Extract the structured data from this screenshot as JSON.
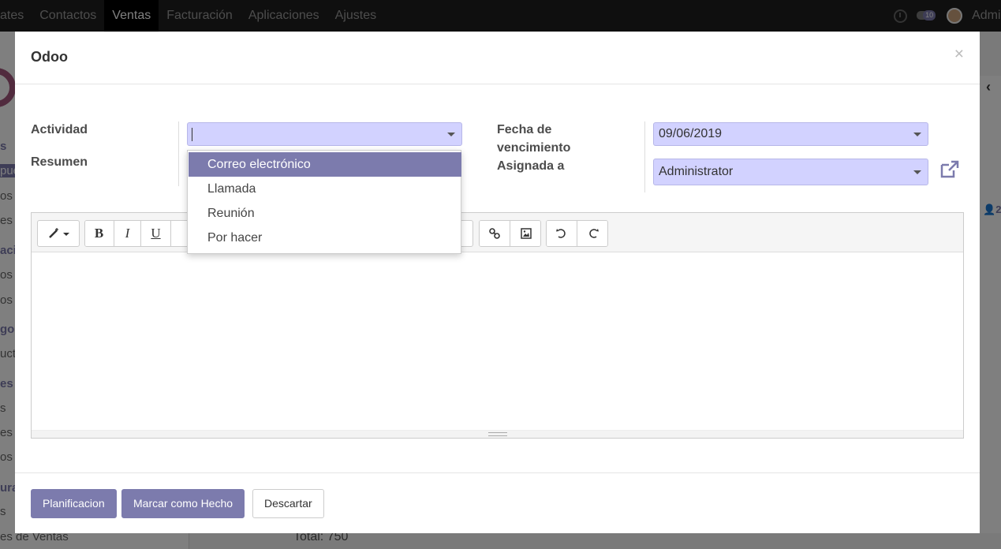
{
  "topbar": {
    "menu": [
      "ates",
      "Contactos",
      "Ventas",
      "Facturación",
      "Aplicaciones",
      "Ajustes"
    ],
    "active_menu": "Ventas",
    "message_count": "10",
    "user": "Admini"
  },
  "background": {
    "sidebar_items": [
      "s",
      "pue",
      "os",
      "es",
      "ació",
      "os",
      "os",
      "go",
      "ucto",
      "es",
      "s",
      "es",
      "os",
      "ura",
      "s",
      "es de Ventas"
    ],
    "total_text": "Total: 750",
    "right_count": "2"
  },
  "modal": {
    "title": "Odoo",
    "close": "×",
    "labels": {
      "actividad": "Actividad",
      "resumen": "Resumen",
      "fecha_line1": "Fecha de",
      "fecha_line2": "vencimiento",
      "asignada": "Asignada a"
    },
    "fields": {
      "actividad_value": "",
      "fecha_vencimiento": "09/06/2019",
      "asignada_a": "Administrator"
    },
    "dropdown": {
      "options": [
        "Correo electrónico",
        "Llamada",
        "Reunión",
        "Por hacer"
      ],
      "highlighted": "Correo electrónico"
    },
    "toolbar": {
      "bold": "B",
      "italic": "I",
      "underline": "U"
    },
    "footer": {
      "plan_button": "Planificacion",
      "done_button": "Marcar como Hecho",
      "discard_button": "Descartar"
    }
  }
}
